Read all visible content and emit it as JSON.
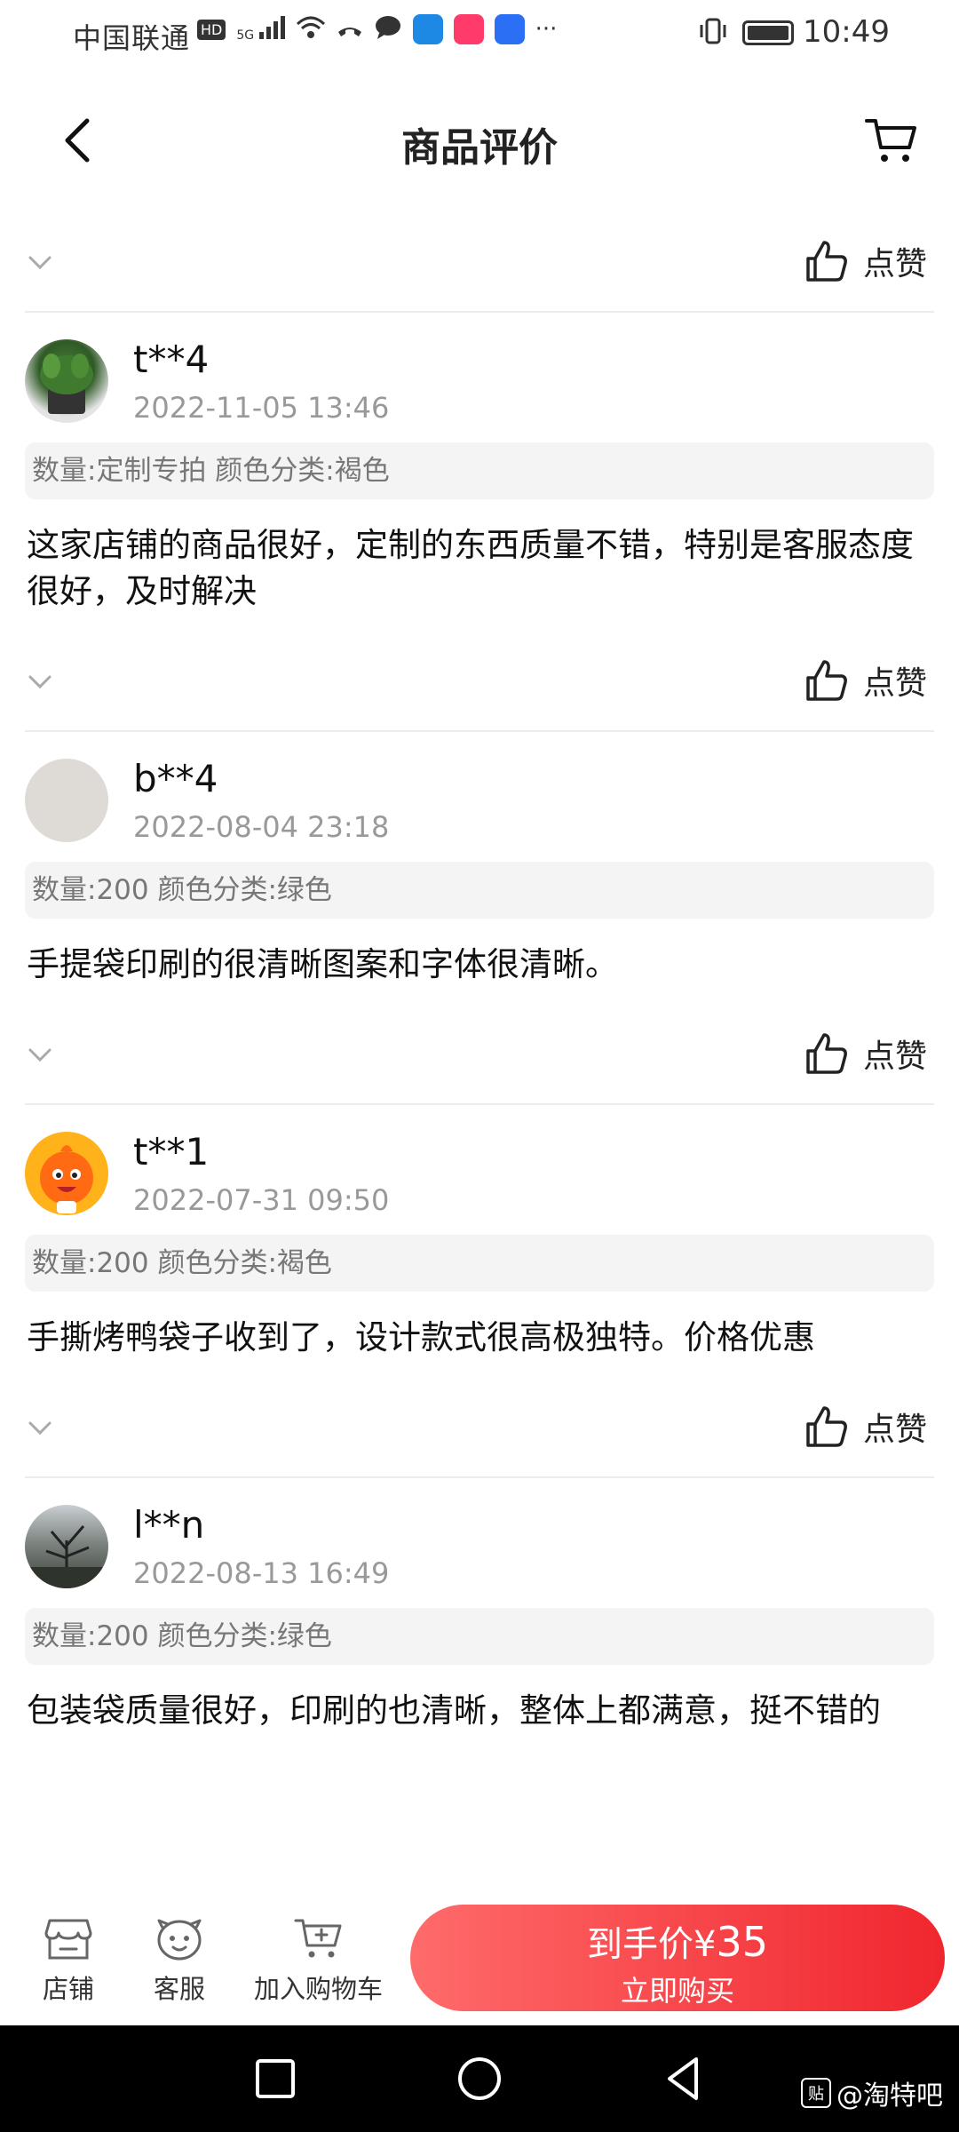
{
  "status_bar": {
    "carrier": "中国联通",
    "hd_badge": "HD",
    "network": "5G",
    "time": "10:49"
  },
  "header": {
    "title": "商品评价"
  },
  "like_label": "点赞",
  "reviews": [
    {
      "username": "t**4",
      "timestamp": "2022-11-05 13:46",
      "spec": "数量:定制专拍 颜色分类:褐色",
      "text": "这家店铺的商品很好，定制的东西质量不错，特别是客服态度很好，及时解决",
      "avatar": "plant-photo"
    },
    {
      "username": "b**4",
      "timestamp": "2022-08-04 23:18",
      "spec": "数量:200 颜色分类:绿色",
      "text": "手提袋印刷的很清晰图案和字体很清晰。",
      "avatar": "grey-circle"
    },
    {
      "username": "t**1",
      "timestamp": "2022-07-31 09:50",
      "spec": "数量:200 颜色分类:褐色",
      "text": "手撕烤鸭袋子收到了，设计款式很高极独特。价格优惠",
      "avatar": "orange-mascot"
    },
    {
      "username": "l**n",
      "timestamp": "2022-08-13 16:49",
      "spec": "数量:200 颜色分类:绿色",
      "text": "包装袋质量很好，印刷的也清晰，整体上都满意，挺不错的",
      "avatar": "tree-photo"
    }
  ],
  "bottom_bar": {
    "shop_label": "店铺",
    "service_label": "客服",
    "add_cart_label": "加入购物车",
    "buy_price_prefix": "到手价¥",
    "buy_price_value": "35",
    "buy_label": "立即购买"
  },
  "watermark": "@淘特吧",
  "colors": {
    "accent": "#f0262e",
    "accent_light": "#ff6b6b",
    "muted_text": "#999999",
    "tag_bg": "#f4f4f4"
  }
}
